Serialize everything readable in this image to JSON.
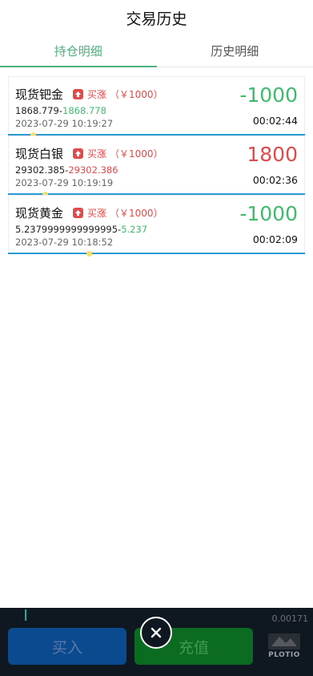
{
  "header": {
    "title": "交易历史"
  },
  "tabs": [
    {
      "label": "持仓明细",
      "active": true
    },
    {
      "label": "历史明细",
      "active": false
    }
  ],
  "positions": [
    {
      "name": "现货钯金",
      "direction": "买涨",
      "amount": "（￥1000）",
      "pnl": "-1000",
      "pnl_type": "neg",
      "price_from": "1868.779",
      "price_sep": "-",
      "price_to": "1868.778",
      "price_to_color": "green",
      "time": "2023-07-29 10:19:27",
      "countdown": "00:02:44",
      "progress": 0.08
    },
    {
      "name": "现货白银",
      "direction": "买涨",
      "amount": "（￥1000）",
      "pnl": "1800",
      "pnl_type": "pos",
      "price_from": "29302.385",
      "price_sep": "-",
      "price_to": "29302.386",
      "price_to_color": "red",
      "time": "2023-07-29 10:19:19",
      "countdown": "00:02:36",
      "progress": 0.12
    },
    {
      "name": "现货黄金",
      "direction": "买涨",
      "amount": "（￥1000）",
      "pnl": "-1000",
      "pnl_type": "neg",
      "price_from": "5.2379999999999995",
      "price_sep": "-",
      "price_to": "5.237",
      "price_to_color": "green",
      "time": "2023-07-29 10:18:52",
      "countdown": "00:02:09",
      "progress": 0.27
    }
  ],
  "bottom_bar": {
    "ticker": "0.00171",
    "buy_label": "买入",
    "recharge_label": "充值",
    "logo_text": "PLOTIO"
  },
  "colors": {
    "accent": "#4caf7d",
    "up": "#e04a4a",
    "down": "#3fbb6e",
    "progress": "#2b9bd6"
  },
  "icons": {
    "direction": "arrow-up-icon",
    "close": "close-icon"
  }
}
